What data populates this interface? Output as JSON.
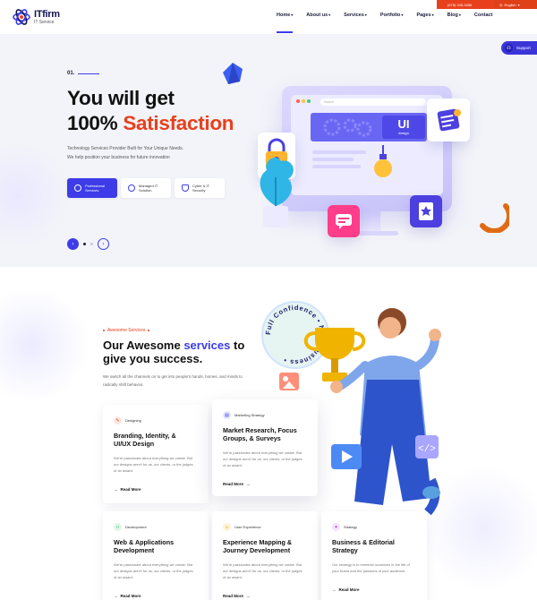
{
  "topbar": {
    "phone": "(678) 345-3456",
    "language": "English"
  },
  "brand": {
    "name": "ITfirm",
    "tagline": "IT Service"
  },
  "nav": [
    {
      "label": "Home",
      "caret": true,
      "active": true
    },
    {
      "label": "About us",
      "caret": true
    },
    {
      "label": "Services",
      "caret": true
    },
    {
      "label": "Portfolio",
      "caret": true
    },
    {
      "label": "Pages",
      "caret": true
    },
    {
      "label": "Blog",
      "caret": true
    },
    {
      "label": "Contact",
      "caret": false
    }
  ],
  "support": {
    "label": "Support"
  },
  "hero": {
    "number": "01.",
    "title_line1": "You will get",
    "title_line2_plain": "100% ",
    "title_line2_accent": "Satisfaction",
    "desc_line1": "Technology Services Provider Built for Your Unique Needs.",
    "desc_line2": "We help position your business for future innovation",
    "buttons": [
      {
        "label_l1": "Professional",
        "label_l2": "Services",
        "icon": "settings-icon"
      },
      {
        "label_l1": "Managed IT",
        "label_l2": "Solution",
        "icon": "gear-icon"
      },
      {
        "label_l1": "Cyber & IT",
        "label_l2": "Security",
        "icon": "shield-icon"
      }
    ],
    "illustration": {
      "search_placeholder": "Search",
      "ui_big": "UI",
      "ui_small": "design"
    }
  },
  "services": {
    "label": "Awesome Services",
    "title_plain": "Our Awesome ",
    "title_accent": "services",
    "title_rest": " to give you success.",
    "desc": "We switch all the channels on to get into people's hands, homes, and minds to radically shift behavior.",
    "badge_text": "Full Confidence • New Business •",
    "cards": [
      {
        "tag": "Designing",
        "title": "Branding, Identity, & UI/UX Design",
        "desc": "We're passionate about everything we create. But our designs aren't for us, our clients, or the judges of an award.",
        "more": "Read More",
        "color": "#e8401c",
        "icon": "brush-icon"
      },
      {
        "tag": "Marketing Strategy",
        "title": "Market Research, Focus Groups, & Surveys",
        "desc": "We're passionate about everything we create. But our designs aren't for us, our clients, or the judges of an award.",
        "more": "Read More",
        "color": "#3d3ce8",
        "icon": "chart-icon"
      },
      {
        "tag": "Development",
        "title": "Web & Applications Development",
        "desc": "We're passionate about everything we create. But our designs aren't for us, our clients, or the judges of an award.",
        "more": "Read More",
        "color": "#19a35a",
        "icon": "code-icon"
      },
      {
        "tag": "User Experience",
        "title": "Experience Mapping & Journey Development",
        "desc": "We're passionate about everything we create. But our designs aren't for us, our clients, or the judges of an award.",
        "more": "Read More",
        "color": "#f0a000",
        "icon": "smile-icon"
      },
      {
        "tag": "Strategy",
        "title": "Business & Editorial Strategy",
        "desc": "Our strategy is to immerse ourselves in the life of your brand and the passions of your audience.",
        "more": "Read More",
        "color": "#a838e0",
        "icon": "bulb-icon"
      }
    ]
  },
  "colors": {
    "accent_blue": "#3d3ce8",
    "accent_orange": "#e8401c",
    "hero_bg": "#f3f4f9"
  }
}
